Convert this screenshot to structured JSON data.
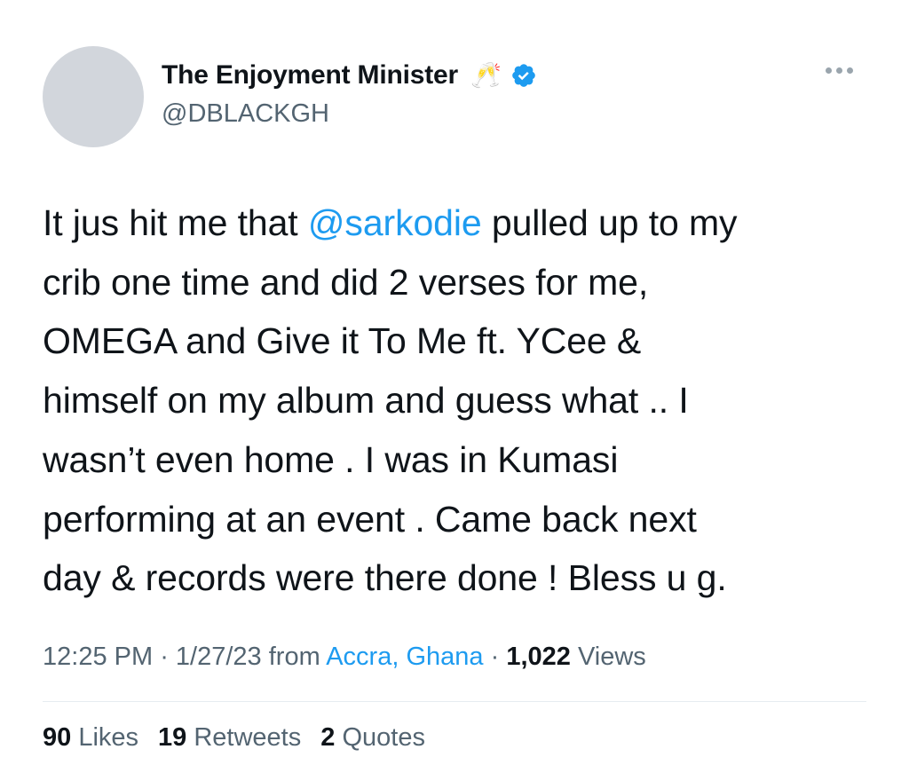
{
  "author": {
    "display_name": "The Enjoyment Minister",
    "emoji": "🥂",
    "handle": "@DBLACKGH",
    "verified": true
  },
  "tweet": {
    "lines": [
      {
        "before": "It jus hit me that ",
        "mention": "@sarkodie",
        "after": " pulled up to my"
      },
      "crib one time and did 2 verses for me,",
      "OMEGA and Give it To Me ft. YCee &",
      "himself on my album and guess what .. I",
      "wasn’t even home . I was in Kumasi",
      "performing at an event . Came back next",
      "day & records were there done ! Bless u g."
    ]
  },
  "meta": {
    "time": "12:25 PM",
    "sep1": " · ",
    "date": "1/27/23",
    "from_label": " from ",
    "location": "Accra, Ghana",
    "sep2": " · ",
    "views_count": "1,022",
    "views_label": " Views"
  },
  "stats": {
    "likes_count": "90",
    "likes_label": " Likes",
    "retweets_count": "19",
    "retweets_label": " Retweets",
    "quotes_count": "2",
    "quotes_label": " Quotes"
  },
  "icons": {
    "verified": "verified-badge-icon",
    "more": "more-options-icon"
  },
  "colors": {
    "accent": "#1d9bf0",
    "text": "#0f1419",
    "secondary": "#536471",
    "avatar_placeholder": "#d2d6dc"
  }
}
